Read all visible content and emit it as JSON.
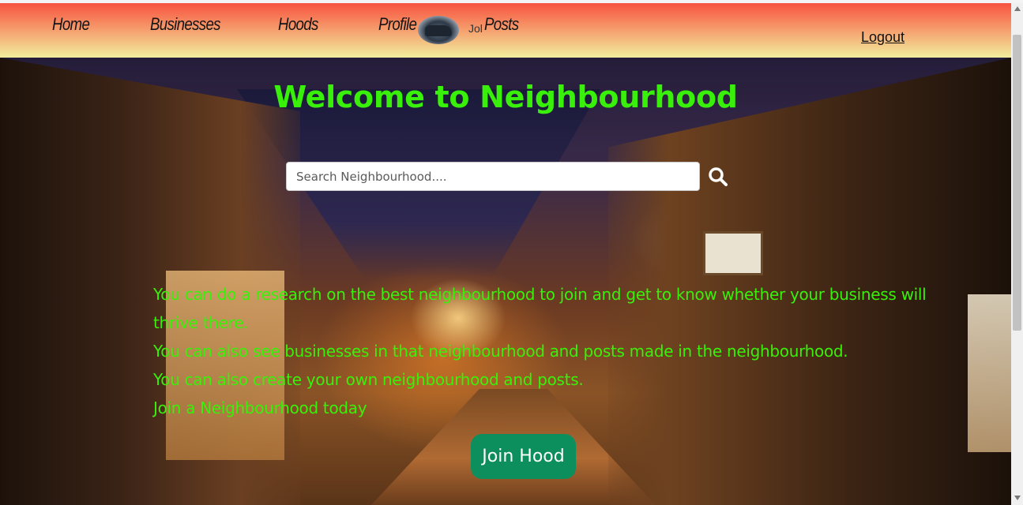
{
  "navbar": {
    "links": [
      {
        "label": "Home"
      },
      {
        "label": "Businesses"
      },
      {
        "label": "Hoods"
      },
      {
        "label": "Profile"
      },
      {
        "label": "Posts"
      }
    ],
    "username": "Jol",
    "logout_label": "Logout"
  },
  "hero": {
    "title": "Welcome to Neighbourhood",
    "search": {
      "placeholder": "Search Neighbourhood....",
      "value": ""
    },
    "description": [
      "You can do a research on the best neighbourhood to join and get to know whether your business will thrive there.",
      "You can also see businesses in that neighbourhood and posts made in the neighbourhood.",
      "You can also create your own neighbourhood and posts.",
      "Join a Neighbourhood today"
    ],
    "join_button_label": "Join Hood"
  },
  "colors": {
    "accent_text": "#39f00a",
    "button_bg": "#0d8f5d",
    "navbar_top": "#f7533f",
    "navbar_bottom": "#f1ee9e"
  },
  "icons": [
    "search-icon",
    "user-avatar"
  ]
}
